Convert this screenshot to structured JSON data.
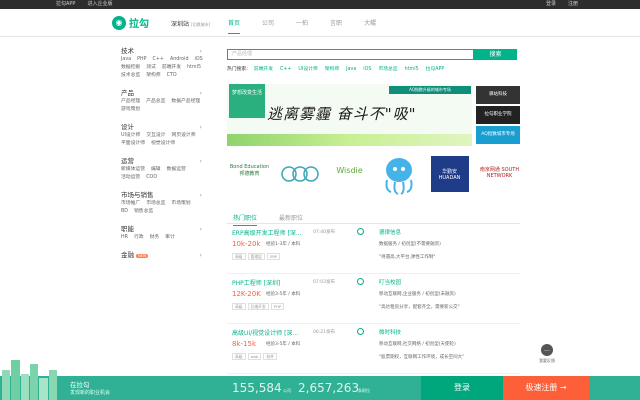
{
  "topbar": {
    "app": "拉勾APP",
    "enterprise": "进入企业版",
    "login": "登录",
    "register": "注册"
  },
  "header": {
    "logo": "拉勾",
    "city": "深圳站",
    "city_switch": "[切换城市]",
    "nav": [
      "首页",
      "公司",
      "一拍",
      "言职",
      "大鲲"
    ]
  },
  "sidebar": [
    {
      "title": "技术",
      "items": [
        "Java",
        "PHP",
        "C++",
        "Android",
        "iOS",
        "数据挖掘",
        "测试",
        "前端开发",
        "html5",
        "技术总监",
        "架构师",
        "CTO"
      ]
    },
    {
      "title": "产品",
      "items": [
        "产品经理",
        "产品总监",
        "数据产品经理",
        "游戏策划"
      ]
    },
    {
      "title": "设计",
      "items": [
        "UI设计师",
        "交互设计",
        "网页设计师",
        "平面设计师",
        "视觉设计师"
      ]
    },
    {
      "title": "运营",
      "items": [
        "新媒体运营",
        "编辑",
        "数据运营",
        "活动运营",
        "COO"
      ]
    },
    {
      "title": "市场与销售",
      "items": [
        "市场推广",
        "市场总监",
        "市场策划",
        "BD",
        "销售总监"
      ]
    },
    {
      "title": "职能",
      "items": [
        "HR",
        "行政",
        "财务",
        "审计"
      ]
    },
    {
      "title": "金融",
      "badge": "NEW",
      "items": []
    }
  ],
  "search": {
    "placeholder": "产品经理",
    "button": "搜索"
  },
  "hot": {
    "label": "热门搜索:",
    "items": [
      "前端开发",
      "C++",
      "UI设计师",
      "架构师",
      "Java",
      "iOS",
      "市场总监",
      "html5",
      "拉勾APP"
    ]
  },
  "banner": {
    "cube": "梦想改变生活",
    "strip": "AQ指数升级的城市专场",
    "slogan": "逃离雾霾 奋斗不\"吸\""
  },
  "sideads": [
    "驿站科技",
    "拉勾职业学院",
    "AQ指数城市专场"
  ],
  "logos": [
    "Bond Education 邦德教育",
    "PSA",
    "Wisdie",
    "章鱼",
    "华勤安 HUADAN",
    "南京网通 SOUTH NETWORK"
  ],
  "tabs": [
    "热门职位",
    "最新职位"
  ],
  "jobs": [
    {
      "title": "ERP高级开发工程师 [深...",
      "time": "07:40发布",
      "salary": "10k-20k",
      "req": "经验1-3年 / 本科",
      "tags": [
        "高级",
        "管理层",
        "ERP"
      ],
      "company": "德律信息",
      "industry": "数据服务 / 初创型(不需要融资)",
      "quote": "\"待遇高,大平台,弹性工作制\""
    },
    {
      "title": "PHP工程师 [深圳]",
      "time": "07:03发布",
      "salary": "12K-20K",
      "req": "经验3-5年 / 本科",
      "tags": [
        "高级",
        "后端开发",
        "PHP"
      ],
      "company": "叮当校园",
      "industry": "移动互联网,企业服务 / 初创型(未融资)",
      "quote": "\"高达租房分享，配套齐全，需要新公交\""
    },
    {
      "title": "高级UI/视觉设计师 [深...",
      "time": "06:21发布",
      "salary": "8k-15k",
      "req": "经验3-5年 / 本科",
      "tags": [
        "高级",
        "web",
        "软件"
      ],
      "company": "微时科技",
      "industry": "移动互联网,社交网络 / 初创型(天使轮)",
      "quote": "\"股票期权，互联网工作环境，成长空间大\""
    }
  ],
  "bottom": {
    "slogan": "在拉勾",
    "sub": "发现新的职业机会",
    "n1": "155,584",
    "u1": "公司",
    "n2": "2,657,263",
    "u2": "条职位",
    "login": "登录",
    "register": "极速注册 →"
  },
  "feedback": "我要反馈",
  "colors": {
    "brand": "#00b38a",
    "salary": "#fd5f39",
    "register": "#fd5f39"
  }
}
